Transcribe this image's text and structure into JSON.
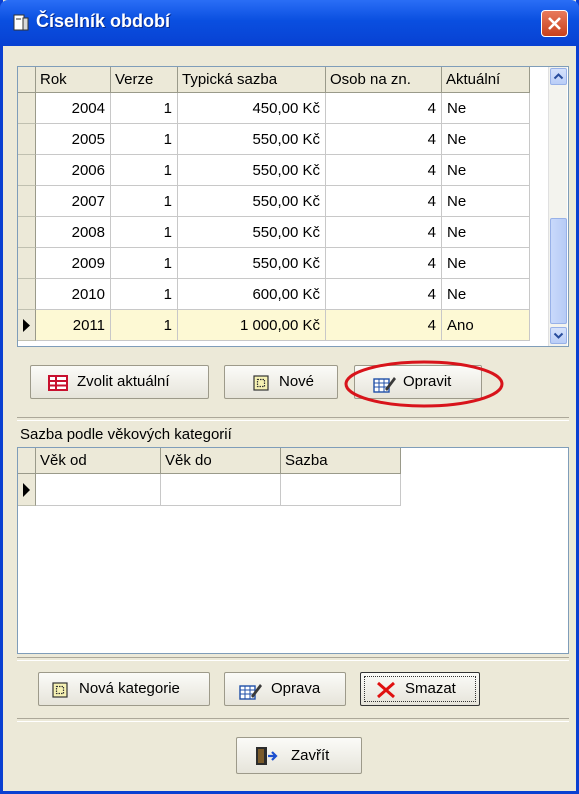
{
  "window": {
    "title": "Číselník období",
    "close_icon": "close-icon"
  },
  "periods": {
    "columns": [
      "Rok",
      "Verze",
      "Typická sazba",
      "Osob na zn.",
      "Aktuální"
    ],
    "rows": [
      [
        "2004",
        "1",
        "450,00 Kč",
        "4",
        "Ne"
      ],
      [
        "2005",
        "1",
        "550,00 Kč",
        "4",
        "Ne"
      ],
      [
        "2006",
        "1",
        "550,00 Kč",
        "4",
        "Ne"
      ],
      [
        "2007",
        "1",
        "550,00 Kč",
        "4",
        "Ne"
      ],
      [
        "2008",
        "1",
        "550,00 Kč",
        "4",
        "Ne"
      ],
      [
        "2009",
        "1",
        "550,00 Kč",
        "4",
        "Ne"
      ],
      [
        "2010",
        "1",
        "600,00 Kč",
        "4",
        "Ne"
      ],
      [
        "2011",
        "1",
        "1 000,00 Kč",
        "4",
        "Ano"
      ]
    ],
    "selected_row": 7
  },
  "period_buttons": {
    "set_current": "Zvolit aktuální",
    "new": "Nové",
    "edit": "Opravit"
  },
  "categories": {
    "label": "Sazba podle věkových kategorií",
    "columns": [
      "Věk od",
      "Věk do",
      "Sazba"
    ]
  },
  "category_buttons": {
    "new": "Nová kategorie",
    "edit": "Oprava",
    "delete": "Smazat"
  },
  "footer": {
    "close": "Zavřít"
  },
  "colors": {
    "title_bar": "#0a4fe0",
    "highlight_circle": "#d8141b",
    "selected_row": "#fdf9d4",
    "close_button": "#c8401c"
  }
}
